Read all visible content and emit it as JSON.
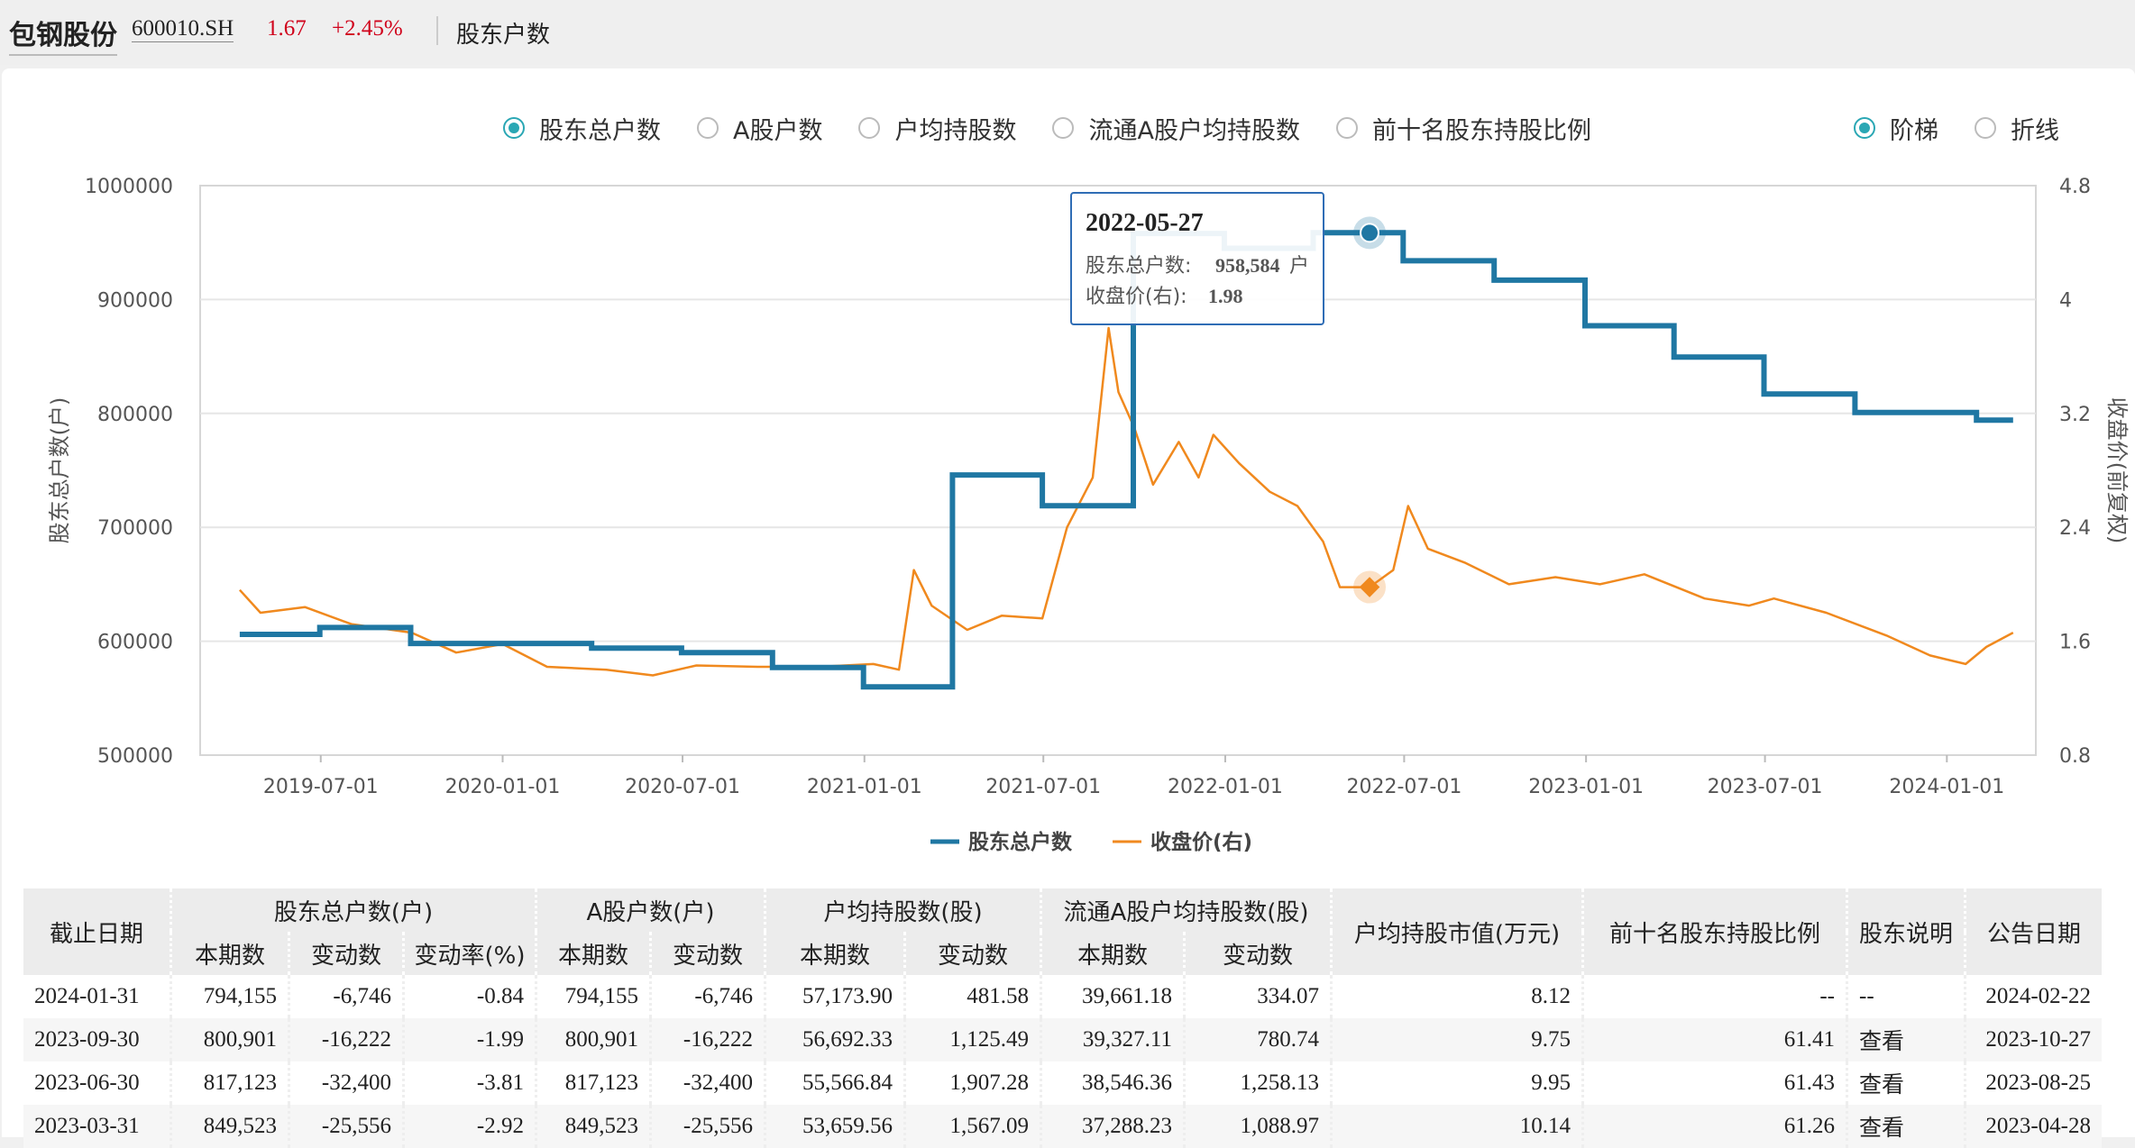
{
  "header": {
    "stock_name": "包钢股份",
    "stock_code": "600010.SH",
    "price": "1.67",
    "change_pct": "+2.45%",
    "tab_label": "股东户数"
  },
  "metric_options": [
    {
      "label": "股东总户数",
      "checked": true
    },
    {
      "label": "A股户数",
      "checked": false
    },
    {
      "label": "户均持股数",
      "checked": false
    },
    {
      "label": "流通A股户均持股数",
      "checked": false
    },
    {
      "label": "前十名股东持股比例",
      "checked": false
    }
  ],
  "style_options": [
    {
      "label": "阶梯",
      "checked": true
    },
    {
      "label": "折线",
      "checked": false
    }
  ],
  "colors": {
    "accent": "#2aa7b4",
    "holders_line": "#1f77a3",
    "price_line": "#f0891e",
    "up": "#d0021b"
  },
  "tooltip": {
    "date": "2022-05-27",
    "holders_label": "股东总户数:",
    "holders_value": "958,584",
    "holders_unit": "户",
    "price_label": "收盘价(右):",
    "price_value": "1.98"
  },
  "chart_data": {
    "type": "line",
    "ylabel": "股东总户数(户)",
    "y2label": "收盘价(前复权)",
    "ylim": [
      500000,
      1000000
    ],
    "y2lim": [
      0.8,
      4.8
    ],
    "yticks": [
      "1000000",
      "900000",
      "800000",
      "700000",
      "600000",
      "500000"
    ],
    "y2ticks": [
      "4.8",
      "4",
      "3.2",
      "2.4",
      "1.6",
      "0.8"
    ],
    "xticks": [
      "2019-07-01",
      "2020-01-01",
      "2020-07-01",
      "2021-01-01",
      "2021-07-01",
      "2022-01-01",
      "2022-07-01",
      "2023-01-01",
      "2023-07-01",
      "2024-01-01"
    ],
    "legend_position": "bottom",
    "series": [
      {
        "name": "股东总户数",
        "step": true,
        "points": [
          [
            "2019-04-10",
            606000
          ],
          [
            "2019-06-30",
            612000
          ],
          [
            "2019-09-30",
            598000
          ],
          [
            "2019-12-31",
            598000
          ],
          [
            "2020-03-31",
            594000
          ],
          [
            "2020-06-30",
            590000
          ],
          [
            "2020-09-30",
            577000
          ],
          [
            "2020-12-31",
            560000
          ],
          [
            "2021-03-31",
            746000
          ],
          [
            "2021-06-30",
            719000
          ],
          [
            "2021-09-30",
            958000
          ],
          [
            "2021-12-31",
            945000
          ],
          [
            "2022-03-31",
            958584
          ],
          [
            "2022-06-30",
            934000
          ],
          [
            "2022-09-30",
            917000
          ],
          [
            "2022-12-31",
            877000
          ],
          [
            "2023-03-31",
            849523
          ],
          [
            "2023-06-30",
            817123
          ],
          [
            "2023-09-30",
            800901
          ],
          [
            "2024-01-31",
            794155
          ],
          [
            "2024-03-08",
            794155
          ]
        ]
      },
      {
        "name": "收盘价(右)",
        "points": [
          [
            "2019-04-10",
            1.96
          ],
          [
            "2019-05-01",
            1.8
          ],
          [
            "2019-06-15",
            1.84
          ],
          [
            "2019-08-01",
            1.72
          ],
          [
            "2019-10-01",
            1.66
          ],
          [
            "2019-11-15",
            1.52
          ],
          [
            "2020-01-01",
            1.58
          ],
          [
            "2020-02-15",
            1.42
          ],
          [
            "2020-04-15",
            1.4
          ],
          [
            "2020-06-01",
            1.36
          ],
          [
            "2020-07-15",
            1.43
          ],
          [
            "2020-09-15",
            1.42
          ],
          [
            "2020-11-15",
            1.42
          ],
          [
            "2021-01-10",
            1.44
          ],
          [
            "2021-02-05",
            1.4
          ],
          [
            "2021-02-20",
            2.1
          ],
          [
            "2021-03-10",
            1.85
          ],
          [
            "2021-04-15",
            1.68
          ],
          [
            "2021-05-20",
            1.78
          ],
          [
            "2021-06-30",
            1.76
          ],
          [
            "2021-07-25",
            2.4
          ],
          [
            "2021-08-20",
            2.75
          ],
          [
            "2021-09-05",
            3.8
          ],
          [
            "2021-09-15",
            3.35
          ],
          [
            "2021-10-01",
            3.1
          ],
          [
            "2021-10-20",
            2.7
          ],
          [
            "2021-11-15",
            3.0
          ],
          [
            "2021-12-05",
            2.75
          ],
          [
            "2021-12-20",
            3.05
          ],
          [
            "2022-01-15",
            2.85
          ],
          [
            "2022-02-15",
            2.65
          ],
          [
            "2022-03-15",
            2.55
          ],
          [
            "2022-04-10",
            2.3
          ],
          [
            "2022-04-27",
            1.98
          ],
          [
            "2022-05-27",
            1.98
          ],
          [
            "2022-06-20",
            2.1
          ],
          [
            "2022-07-05",
            2.55
          ],
          [
            "2022-07-25",
            2.25
          ],
          [
            "2022-09-01",
            2.15
          ],
          [
            "2022-10-15",
            2.0
          ],
          [
            "2022-12-01",
            2.05
          ],
          [
            "2023-01-15",
            2.0
          ],
          [
            "2023-03-01",
            2.07
          ],
          [
            "2023-05-01",
            1.9
          ],
          [
            "2023-06-15",
            1.85
          ],
          [
            "2023-07-10",
            1.9
          ],
          [
            "2023-09-01",
            1.8
          ],
          [
            "2023-11-01",
            1.64
          ],
          [
            "2023-12-15",
            1.5
          ],
          [
            "2024-01-20",
            1.44
          ],
          [
            "2024-02-10",
            1.56
          ],
          [
            "2024-03-08",
            1.66
          ]
        ]
      }
    ]
  },
  "table": {
    "group_headers": [
      "截止日期",
      "股东总户数(户)",
      "A股户数(户)",
      "户均持股数(股)",
      "流通A股户均持股数(股)",
      "户均持股市值(万元)",
      "前十名股东持股比例",
      "股东说明",
      "公告日期"
    ],
    "sub_headers": [
      "本期数",
      "变动数",
      "变动率(%)",
      "本期数",
      "变动数",
      "本期数",
      "变动数",
      "本期数",
      "变动数"
    ],
    "rows": [
      [
        "2024-01-31",
        "794,155",
        "-6,746",
        "-0.84",
        "794,155",
        "-6,746",
        "57,173.90",
        "481.58",
        "39,661.18",
        "334.07",
        "8.12",
        "--",
        "--",
        "2024-02-22"
      ],
      [
        "2023-09-30",
        "800,901",
        "-16,222",
        "-1.99",
        "800,901",
        "-16,222",
        "56,692.33",
        "1,125.49",
        "39,327.11",
        "780.74",
        "9.75",
        "61.41",
        "查看",
        "2023-10-27"
      ],
      [
        "2023-06-30",
        "817,123",
        "-32,400",
        "-3.81",
        "817,123",
        "-32,400",
        "55,566.84",
        "1,907.28",
        "38,546.36",
        "1,258.13",
        "9.95",
        "61.43",
        "查看",
        "2023-08-25"
      ],
      [
        "2023-03-31",
        "849,523",
        "-25,556",
        "-2.92",
        "849,523",
        "-25,556",
        "53,659.56",
        "1,567.09",
        "37,288.23",
        "1,088.97",
        "10.14",
        "61.26",
        "查看",
        "2023-04-28"
      ]
    ]
  }
}
